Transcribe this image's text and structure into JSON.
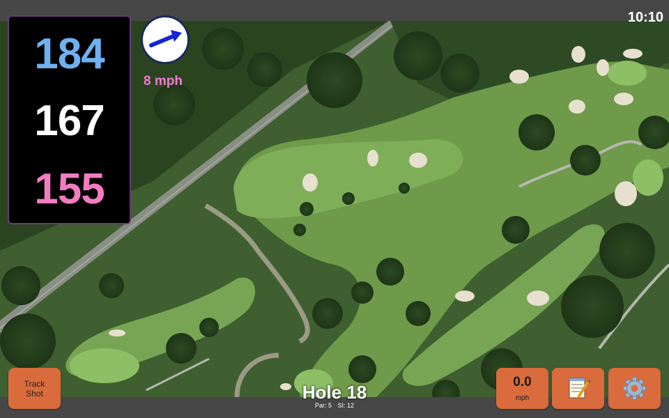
{
  "status": {
    "time": "10:10"
  },
  "distances": {
    "back": "184",
    "middle": "167",
    "front": "155"
  },
  "wind": {
    "speed": "8 mph",
    "icon": "wind-direction-arrow-icon"
  },
  "buttons": {
    "track_shot_line1": "Track",
    "track_shot_line2": "Shot",
    "speed_value": "0.0",
    "speed_unit": "mph",
    "notes_icon": "notepad-icon",
    "settings_icon": "gear-icon"
  },
  "hole": {
    "title": "Hole 18",
    "par": "Par: 5",
    "stroke_index": "SI: 12"
  },
  "colors": {
    "back_distance": "#6fb0f0",
    "middle_distance": "#ffffff",
    "front_distance": "#f27cc0",
    "wind_text": "#f07bd0",
    "button_bg": "#d96b3d"
  }
}
